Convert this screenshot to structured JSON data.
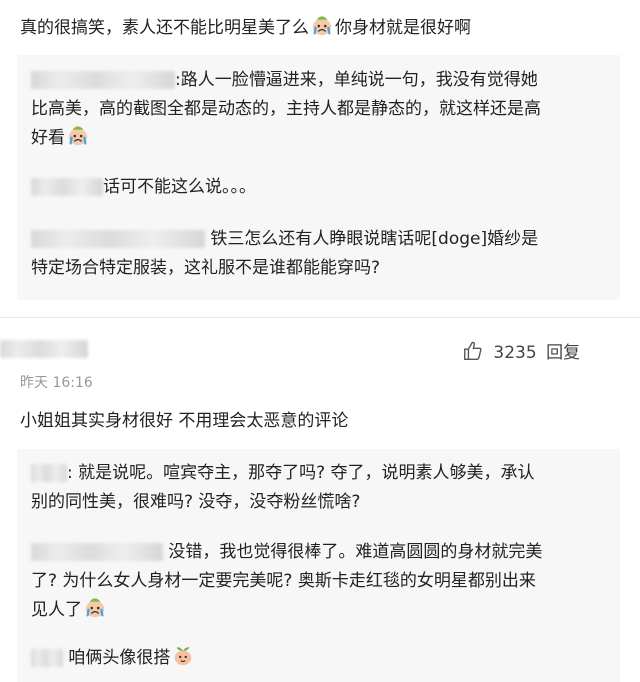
{
  "comment1": {
    "text": "真的很搞笑，素人还不能比明星美了么",
    "text_after_emoji": "你身材就是很好啊",
    "emoji_icon": "crying-face-icon",
    "replies": [
      {
        "lines": [
          ":路人一脸懵逼进来，单纯说一句，我没有觉得她",
          "比高美，高的截图全都是动态的，主持人都是静态的，就这样还是高",
          "好看"
        ],
        "emoji_icon": "crying-face-icon"
      },
      {
        "lines": [
          "话可不能这么说。。。"
        ]
      },
      {
        "lines": [
          "铁三怎么还有人睁眼说瞎话呢[doge]婚纱是",
          "特定场合特定服装，这礼服不是谁都能能穿吗?"
        ]
      }
    ]
  },
  "comment2": {
    "like_icon": "thumbs-up-icon",
    "like_count": "3235",
    "reply_label": "回复",
    "time": "昨天 16:16",
    "text": "小姐姐其实身材很好 不用理会太恶意的评论",
    "replies": [
      {
        "lines": [
          ": 就是说呢。喧宾夺主，那夺了吗? 夺了，说明素人够美，承认",
          "别的同性美，很难吗? 没夺，没夺粉丝慌啥?"
        ]
      },
      {
        "lines": [
          "没错，我也觉得很棒了。难道高圆圆的身材就完美",
          "了? 为什么女人身材一定要完美呢? 奥斯卡走红毯的女明星都别出来",
          "见人了"
        ],
        "emoji_icon": "crying-face-icon"
      },
      {
        "lines": [
          "咱俩头像很搭"
        ],
        "emoji_icon": "sprout-face-icon"
      }
    ]
  }
}
